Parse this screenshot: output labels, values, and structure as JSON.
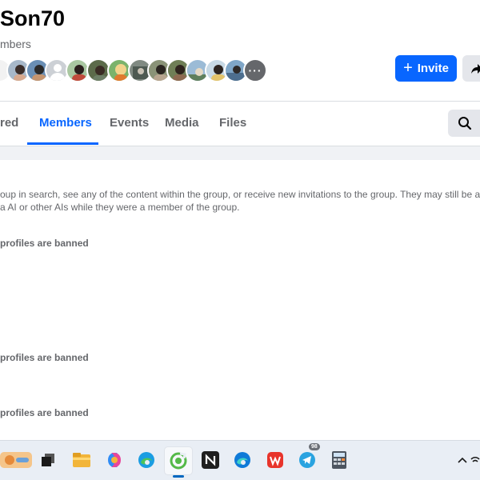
{
  "group": {
    "name": "Son70",
    "member_label": "mbers"
  },
  "header": {
    "avatars": [
      "avatar-1",
      "avatar-2",
      "avatar-3",
      "avatar-4",
      "avatar-5",
      "avatar-6",
      "avatar-7",
      "avatar-8",
      "avatar-9",
      "avatar-10",
      "avatar-11",
      "avatar-12",
      "avatar-13",
      "avatar-14"
    ],
    "more_label": "···",
    "invite_label": "Invite",
    "colors": {
      "accent": "#0866ff",
      "button_gray": "#e4e6eb"
    }
  },
  "tabs": [
    {
      "label": "red",
      "active": false
    },
    {
      "label": "Members",
      "active": true
    },
    {
      "label": "Events",
      "active": false
    },
    {
      "label": "Media",
      "active": false
    },
    {
      "label": "Files",
      "active": false
    }
  ],
  "search_icon": "search-icon",
  "content": {
    "description_line1": "oup in search, see any of the content within the group, or receive new invitations to the group. They may still be abl",
    "description_line2": "a AI or other AIs while they were a member of the group.",
    "banned_labels": [
      "profiles are banned",
      "profiles are banned",
      "profiles are banned"
    ]
  },
  "taskbar": {
    "items": [
      "widgets-icon",
      "task-view-icon",
      "file-explorer-icon",
      "copilot-icon",
      "edge-icon",
      "app-active-icon",
      "notion-icon",
      "edge-beta-icon",
      "wps-office-icon",
      "telegram-icon",
      "calculator-icon"
    ],
    "telegram_badge": "98",
    "tray_icons": [
      "chevron-up-icon",
      "wifi-icon"
    ]
  }
}
